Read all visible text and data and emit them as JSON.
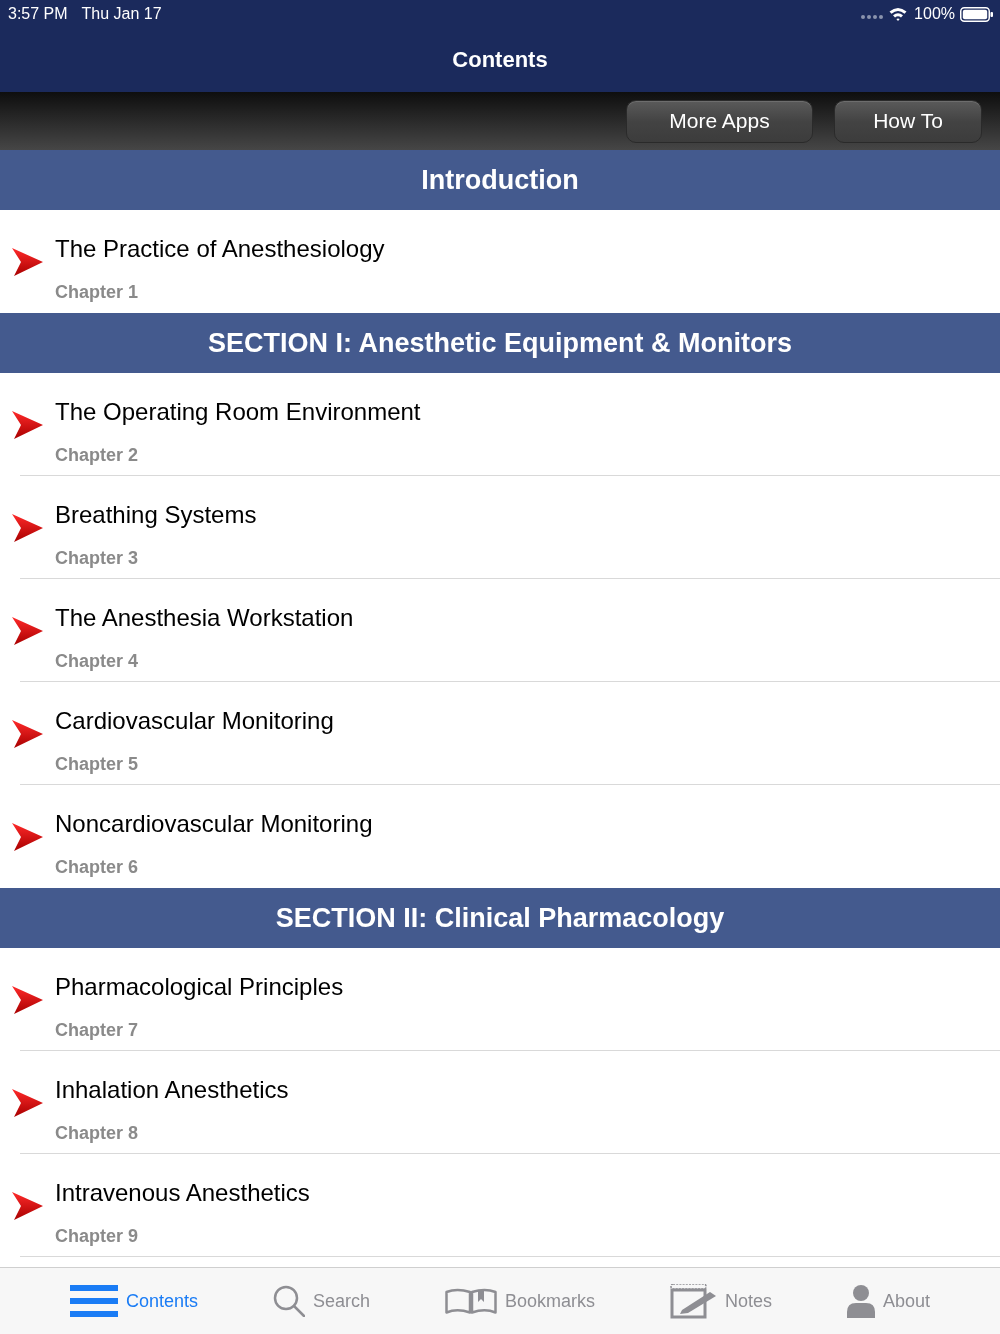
{
  "status_bar": {
    "time": "3:57 PM",
    "date": "Thu Jan 17",
    "battery": "100%"
  },
  "nav_bar": {
    "title": "Contents"
  },
  "toolbar": {
    "buttons": [
      "More Apps",
      "How To"
    ]
  },
  "sections": [
    {
      "title": "Introduction",
      "chapters": [
        {
          "title": "The Practice of Anesthesiology",
          "number": "Chapter 1"
        }
      ]
    },
    {
      "title": "SECTION I: Anesthetic Equipment & Monitors",
      "chapters": [
        {
          "title": "The Operating Room Environment",
          "number": "Chapter 2"
        },
        {
          "title": "Breathing Systems",
          "number": "Chapter 3"
        },
        {
          "title": "The Anesthesia Workstation",
          "number": "Chapter 4"
        },
        {
          "title": "Cardiovascular Monitoring",
          "number": "Chapter 5"
        },
        {
          "title": "Noncardiovascular Monitoring",
          "number": "Chapter 6"
        }
      ]
    },
    {
      "title": "SECTION II: Clinical Pharmacology",
      "chapters": [
        {
          "title": "Pharmacological Principles",
          "number": "Chapter 7"
        },
        {
          "title": "Inhalation Anesthetics",
          "number": "Chapter 8"
        },
        {
          "title": "Intravenous Anesthetics",
          "number": "Chapter 9"
        }
      ]
    }
  ],
  "tab_bar": {
    "items": [
      {
        "label": "Contents",
        "kind": "contents",
        "selected": true
      },
      {
        "label": "Search",
        "kind": "search",
        "selected": false
      },
      {
        "label": "Bookmarks",
        "kind": "bookmarks",
        "selected": false
      },
      {
        "label": "Notes",
        "kind": "notes",
        "selected": false
      },
      {
        "label": "About",
        "kind": "about",
        "selected": false
      }
    ]
  }
}
